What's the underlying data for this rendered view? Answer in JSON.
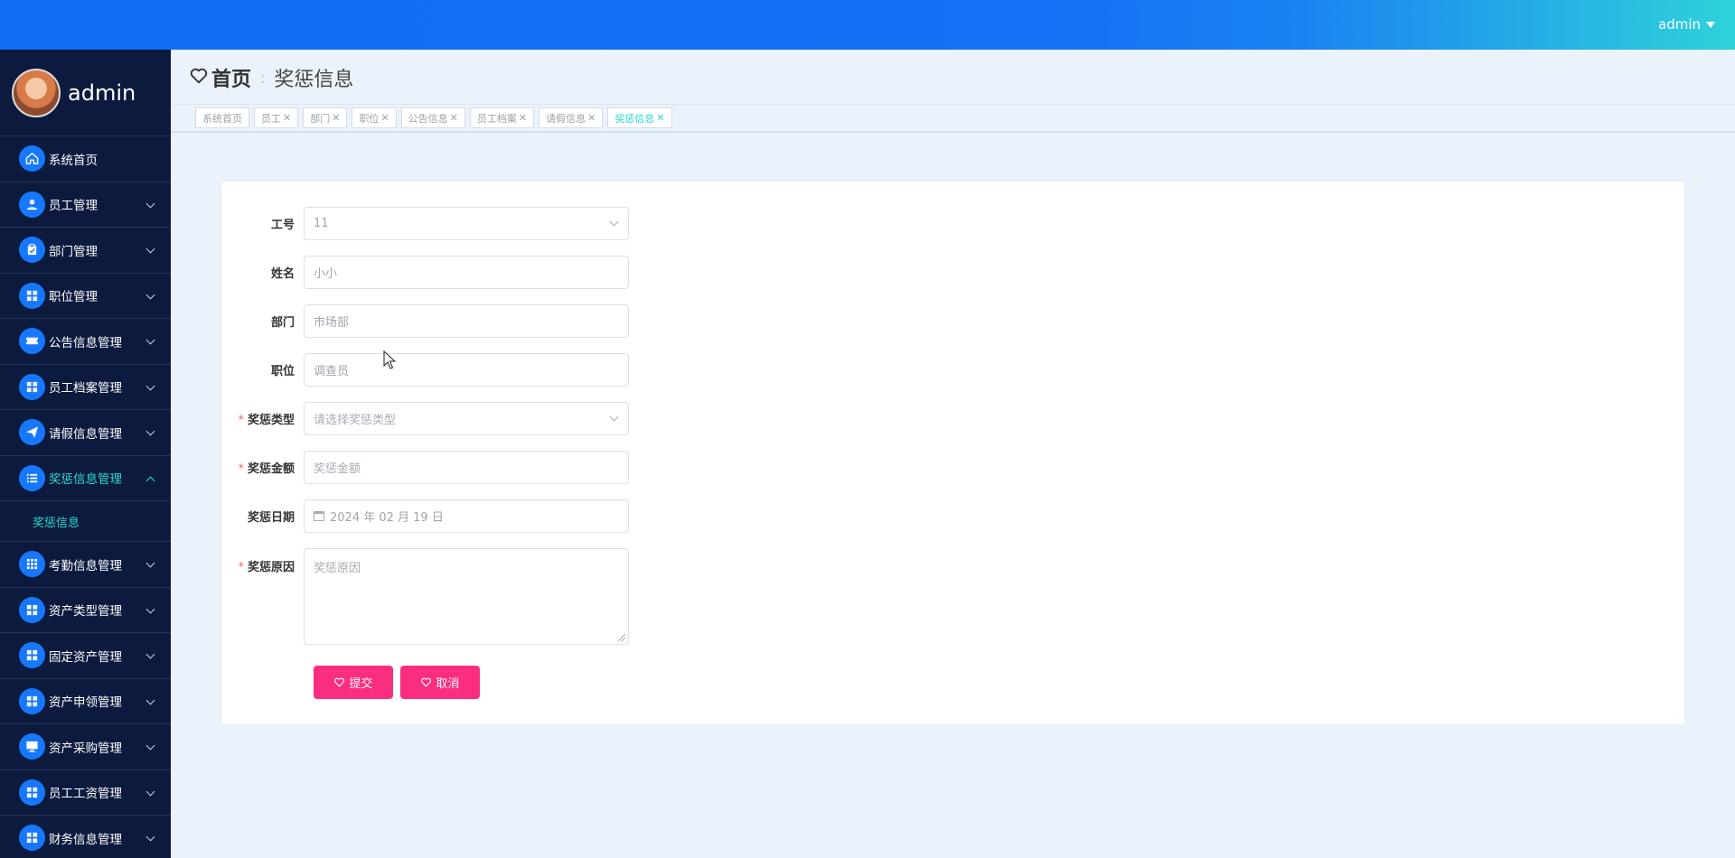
{
  "header": {
    "username": "admin"
  },
  "sidebar": {
    "profile_name": "admin",
    "items": [
      {
        "label": "系统首页",
        "icon": "home-icon"
      },
      {
        "label": "员工管理",
        "icon": "user-icon"
      },
      {
        "label": "部门管理",
        "icon": "clipboard-icon"
      },
      {
        "label": "职位管理",
        "icon": "grid-icon"
      },
      {
        "label": "公告信息管理",
        "icon": "ticket-icon"
      },
      {
        "label": "员工档案管理",
        "icon": "grid-icon"
      },
      {
        "label": "请假信息管理",
        "icon": "send-icon"
      },
      {
        "label": "奖惩信息管理",
        "icon": "list-icon"
      },
      {
        "label": "考勤信息管理",
        "icon": "dots-grid-icon"
      },
      {
        "label": "资产类型管理",
        "icon": "grid-icon"
      },
      {
        "label": "固定资产管理",
        "icon": "grid-icon"
      },
      {
        "label": "资产申领管理",
        "icon": "grid-icon"
      },
      {
        "label": "资产采购管理",
        "icon": "monitor-icon"
      },
      {
        "label": "员工工资管理",
        "icon": "grid-icon"
      },
      {
        "label": "财务信息管理",
        "icon": "grid-icon"
      }
    ],
    "submenu_label": "奖惩信息",
    "accent_color": "#2ed8d1"
  },
  "breadcrumb": {
    "home": "首页",
    "separator": ":",
    "current": "奖惩信息"
  },
  "tabs": [
    {
      "label": "系统首页",
      "closable": false
    },
    {
      "label": "员工",
      "closable": true
    },
    {
      "label": "部门",
      "closable": true
    },
    {
      "label": "职位",
      "closable": true
    },
    {
      "label": "公告信息",
      "closable": true
    },
    {
      "label": "员工档案",
      "closable": true
    },
    {
      "label": "请假信息",
      "closable": true
    },
    {
      "label": "奖惩信息",
      "closable": true
    }
  ],
  "form": {
    "gonghao": {
      "label": "工号",
      "value": "11"
    },
    "xingming": {
      "label": "姓名",
      "value": "小小"
    },
    "bumen": {
      "label": "部门",
      "value": "市场部"
    },
    "zhiwei": {
      "label": "职位",
      "value": "调查员"
    },
    "leixing": {
      "label": "奖惩类型",
      "placeholder": "请选择奖惩类型",
      "required": "*"
    },
    "jine": {
      "label": "奖惩金额",
      "placeholder": "奖惩金额",
      "required": "*"
    },
    "riqi": {
      "label": "奖惩日期",
      "value": "2024 年 02 月 19 日"
    },
    "yuanyin": {
      "label": "奖惩原因",
      "placeholder": "奖惩原因",
      "required": "*"
    },
    "submit_label": "提交",
    "cancel_label": "取消",
    "button_color": "#fb2d7f"
  }
}
